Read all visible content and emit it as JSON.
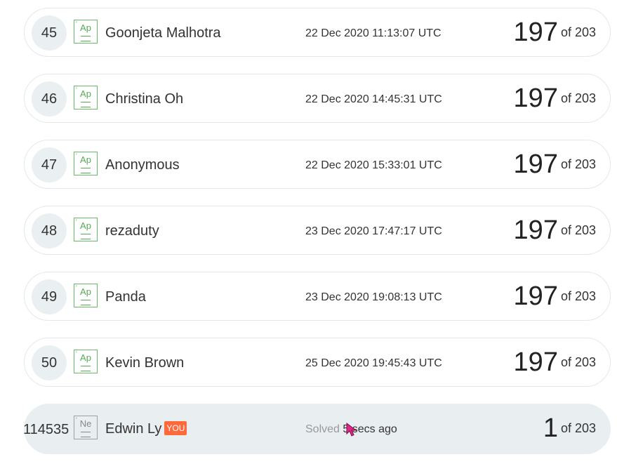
{
  "leaderboard": {
    "rows": [
      {
        "rank": "45",
        "badge": "Ap",
        "name": "Goonjeta Malhotra",
        "timestamp": "22 Dec 2020 11:13:07 UTC",
        "score": "197",
        "of_total": "of 203"
      },
      {
        "rank": "46",
        "badge": "Ap",
        "name": "Christina Oh",
        "timestamp": "22 Dec 2020 14:45:31 UTC",
        "score": "197",
        "of_total": "of 203"
      },
      {
        "rank": "47",
        "badge": "Ap",
        "name": "Anonymous",
        "timestamp": "22 Dec 2020 15:33:01 UTC",
        "score": "197",
        "of_total": "of 203"
      },
      {
        "rank": "48",
        "badge": "Ap",
        "name": "rezaduty",
        "timestamp": "23 Dec 2020 17:47:17 UTC",
        "score": "197",
        "of_total": "of 203"
      },
      {
        "rank": "49",
        "badge": "Ap",
        "name": "Panda",
        "timestamp": "23 Dec 2020 19:08:13 UTC",
        "score": "197",
        "of_total": "of 203"
      },
      {
        "rank": "50",
        "badge": "Ap",
        "name": "Kevin Brown",
        "timestamp": "25 Dec 2020 19:45:43 UTC",
        "score": "197",
        "of_total": "of 203"
      }
    ],
    "current_user": {
      "rank": "114535",
      "badge": "Ne",
      "name": "Edwin Ly",
      "you_tag": "YOU",
      "solved_label": "Solved",
      "solved_value": "5",
      "solved_suffix": "secs ago",
      "score": "1",
      "of_total": "of 203"
    }
  },
  "colors": {
    "badge_green": "#66bb66",
    "badge_gray": "#a0a0a0",
    "you_tag": "#ff6a3d",
    "current_row_bg": "#e9eef0",
    "cursor": "#e0288a"
  },
  "icons": {
    "badge": "level-badge-icon",
    "cursor": "mouse-pointer-icon"
  }
}
